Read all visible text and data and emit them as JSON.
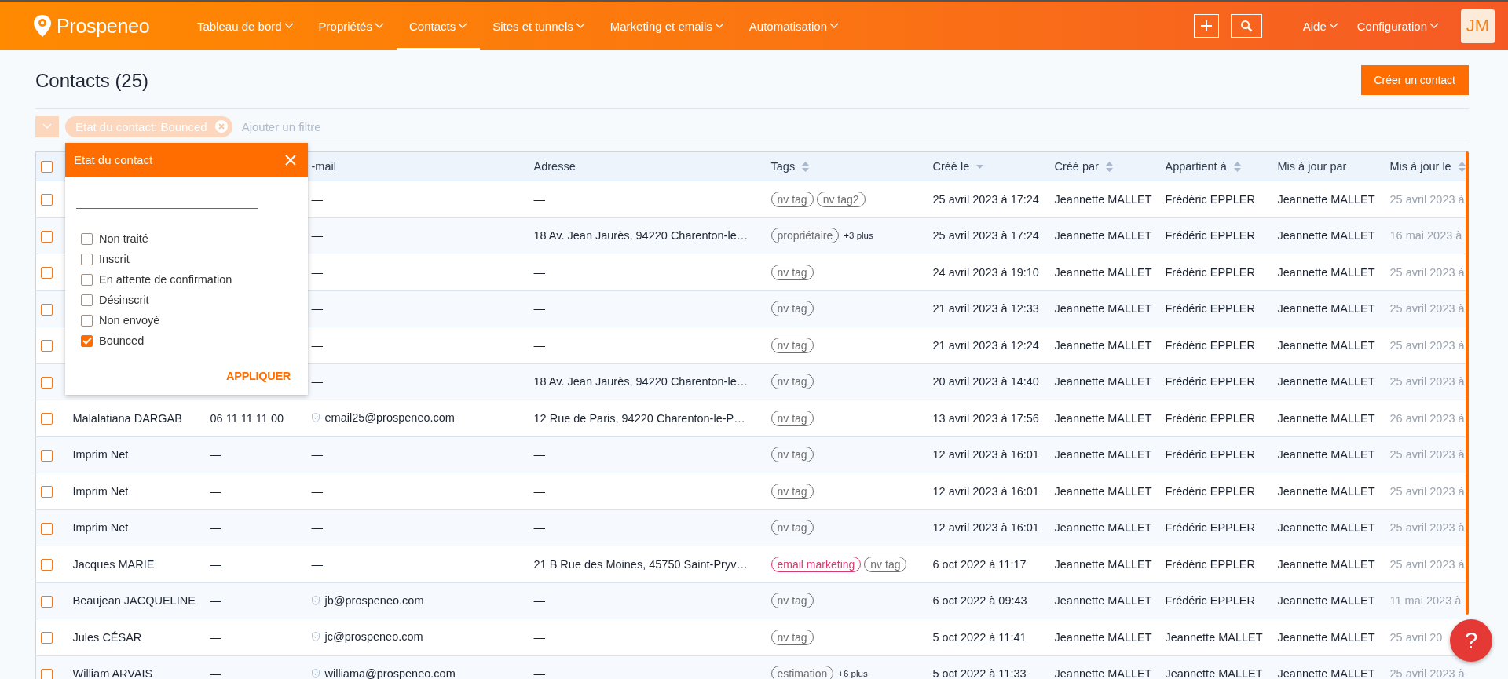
{
  "nav": {
    "logo": "**Prospe**neo",
    "items": [
      {
        "label": "Tableau de bord",
        "selected": false
      },
      {
        "label": "Propriétés",
        "selected": false
      },
      {
        "label": "Contacts",
        "selected": true
      },
      {
        "label": "Sites et tunnels",
        "selected": false
      },
      {
        "label": "Marketing et emails",
        "selected": false
      },
      {
        "label": "Automatisation",
        "selected": false
      }
    ],
    "menus": [
      {
        "label": "Aide"
      },
      {
        "label": "Configuration"
      }
    ],
    "avatar": "JM"
  },
  "page": {
    "title": "Contacts (25)",
    "create_button": "Créer un contact"
  },
  "filters": {
    "chips": [
      {
        "label": "Etat du contact: Bounced"
      }
    ],
    "add_placeholder": "Ajouter un filtre"
  },
  "table": {
    "header_checked": false,
    "columns": [
      {
        "label": "-mail",
        "sortable": false,
        "sorted_desc": false
      },
      {
        "label": "Adresse",
        "sortable": false,
        "sorted_desc": false
      },
      {
        "label": "Tags",
        "sortable": true,
        "sorted_desc": false
      },
      {
        "label": "Créé le",
        "sortable": true,
        "sorted_desc": true
      },
      {
        "label": "Créé par",
        "sortable": true,
        "sorted_desc": false
      },
      {
        "label": "Appartient à",
        "sortable": true,
        "sorted_desc": false
      },
      {
        "label": "Mis à jour par",
        "sortable": false,
        "sorted_desc": false
      },
      {
        "label": "Mis à jour le",
        "sortable": true,
        "sorted_desc": false
      }
    ],
    "rows": [
      {
        "checked": false,
        "email": "—",
        "verified": false,
        "address": "—",
        "tags": [
          {
            "label": "nv tag",
            "color": "#6f6f6f"
          },
          {
            "label": "nv tag2",
            "color": "#6f6f6f"
          }
        ],
        "created_on": "25 avril 2023 à 17:24",
        "created_by": "Jeannette MALLET",
        "owner": "Frédéric EPPLER",
        "updated_by": "Jeannette MALLET",
        "updated_on": "25 avril 2023 à"
      },
      {
        "checked": false,
        "email": "—",
        "verified": false,
        "address": "18 Av. Jean Jaurès, 94220 Charenton-le…",
        "tags": [
          {
            "label": "propriétaire",
            "color": "#6f6f6f"
          }
        ],
        "more": "+3 plus",
        "created_on": "25 avril 2023 à 17:24",
        "created_by": "Jeannette MALLET",
        "owner": "Frédéric EPPLER",
        "updated_by": "Jeannette MALLET",
        "updated_on": "16 mai 2023 à"
      },
      {
        "checked": false,
        "email": "—",
        "verified": false,
        "address": "—",
        "tags": [
          {
            "label": "nv tag",
            "color": "#6f6f6f"
          }
        ],
        "created_on": "24 avril 2023 à 19:10",
        "created_by": "Jeannette MALLET",
        "owner": "Frédéric EPPLER",
        "updated_by": "Jeannette MALLET",
        "updated_on": "25 avril 2023 à"
      },
      {
        "checked": false,
        "email": "—",
        "verified": false,
        "address": "—",
        "tags": [
          {
            "label": "nv tag",
            "color": "#6f6f6f"
          }
        ],
        "created_on": "21 avril 2023 à 12:33",
        "created_by": "Jeannette MALLET",
        "owner": "Frédéric EPPLER",
        "updated_by": "Jeannette MALLET",
        "updated_on": "25 avril 2023 à"
      },
      {
        "checked": false,
        "email": "—",
        "verified": false,
        "address": "—",
        "tags": [
          {
            "label": "nv tag",
            "color": "#6f6f6f"
          }
        ],
        "created_on": "21 avril 2023 à 12:24",
        "created_by": "Jeannette MALLET",
        "owner": "Frédéric EPPLER",
        "updated_by": "Jeannette MALLET",
        "updated_on": "25 avril 2023 à"
      },
      {
        "checked": false,
        "email": "—",
        "verified": false,
        "address": "18 Av. Jean Jaurès, 94220 Charenton-le…",
        "tags": [
          {
            "label": "nv tag",
            "color": "#6f6f6f"
          }
        ],
        "created_on": "20 avril 2023 à 14:40",
        "created_by": "Jeannette MALLET",
        "owner": "Frédéric EPPLER",
        "updated_by": "Jeannette MALLET",
        "updated_on": "25 avril 2023 à"
      },
      {
        "checked": false,
        "name": "Malalatiana DARGAB",
        "phone": "06 11 11 11 00",
        "email": "email25@prospeneo.com",
        "verified": true,
        "address": "12 Rue de Paris, 94220 Charenton-le-P…",
        "tags": [
          {
            "label": "nv tag",
            "color": "#6f6f6f"
          }
        ],
        "created_on": "13 avril 2023 à 17:56",
        "created_by": "Jeannette MALLET",
        "owner": "Frédéric EPPLER",
        "updated_by": "Jeannette MALLET",
        "updated_on": "26 avril 2023 à"
      },
      {
        "checked": false,
        "name": "Imprim Net",
        "phone": "—",
        "email": "—",
        "verified": false,
        "address": "—",
        "tags": [
          {
            "label": "nv tag",
            "color": "#6f6f6f"
          }
        ],
        "created_on": "12 avril 2023 à 16:01",
        "created_by": "Jeannette MALLET",
        "owner": "Frédéric EPPLER",
        "updated_by": "Jeannette MALLET",
        "updated_on": "25 avril 2023 à"
      },
      {
        "checked": false,
        "name": "Imprim Net",
        "phone": "—",
        "email": "—",
        "verified": false,
        "address": "—",
        "tags": [
          {
            "label": "nv tag",
            "color": "#6f6f6f"
          }
        ],
        "created_on": "12 avril 2023 à 16:01",
        "created_by": "Jeannette MALLET",
        "owner": "Frédéric EPPLER",
        "updated_by": "Jeannette MALLET",
        "updated_on": "25 avril 2023 à"
      },
      {
        "checked": false,
        "name": "Imprim Net",
        "phone": "—",
        "email": "—",
        "verified": false,
        "address": "—",
        "tags": [
          {
            "label": "nv tag",
            "color": "#6f6f6f"
          }
        ],
        "created_on": "12 avril 2023 à 16:01",
        "created_by": "Jeannette MALLET",
        "owner": "Frédéric EPPLER",
        "updated_by": "Jeannette MALLET",
        "updated_on": "25 avril 2023 à"
      },
      {
        "checked": false,
        "name": "Jacques MARIE",
        "phone": "—",
        "email": "—",
        "verified": false,
        "address": "21 B Rue des Moines, 45750 Saint-Pryv…",
        "tags": [
          {
            "label": "email marketing",
            "color": "#d63a6e"
          },
          {
            "label": "nv tag",
            "color": "#6f6f6f"
          }
        ],
        "created_on": "6 oct 2022 à 11:17",
        "created_by": "Jeannette MALLET",
        "owner": "Frédéric EPPLER",
        "updated_by": "Jeannette MALLET",
        "updated_on": "25 avril 2023 à"
      },
      {
        "checked": false,
        "name": "Beaujean JACQUELINE",
        "phone": "—",
        "email": "jb@prospeneo.com",
        "verified": true,
        "address": "—",
        "tags": [
          {
            "label": "nv tag",
            "color": "#6f6f6f"
          }
        ],
        "created_on": "6 oct 2022 à 09:43",
        "created_by": "Jeannette MALLET",
        "owner": "Frédéric EPPLER",
        "updated_by": "Jeannette MALLET",
        "updated_on": "11 mai 2023 à"
      },
      {
        "checked": false,
        "name": "Jules CÉSAR",
        "phone": "—",
        "email": "jc@prospeneo.com",
        "verified": true,
        "address": "—",
        "tags": [
          {
            "label": "nv tag",
            "color": "#6f6f6f"
          }
        ],
        "created_on": "5 oct 2022 à 11:41",
        "created_by": "Jeannette MALLET",
        "owner": "Jeannette MALLET",
        "updated_by": "Jeannette MALLET",
        "updated_on": "25 avril 20"
      },
      {
        "checked": false,
        "name": "William ARVAIS",
        "phone": "—",
        "email": "williama@prospeneo.com",
        "verified": true,
        "address": "—",
        "tags": [
          {
            "label": "estimation",
            "color": "#6f6f6f"
          }
        ],
        "more": "+6 plus",
        "created_on": "5 oct 2022 à 11:33",
        "created_by": "Jeannette MALLET",
        "owner": "Jeannette MALLET",
        "updated_by": "Jeannette MALLET",
        "updated_on": "25 avril 2023 à"
      }
    ]
  },
  "filter_popup": {
    "title": "Etat du contact",
    "options": [
      {
        "label": "Non traité",
        "checked": false
      },
      {
        "label": "Inscrit",
        "checked": false
      },
      {
        "label": "En attente de confirmation",
        "checked": false
      },
      {
        "label": "Désinscrit",
        "checked": false
      },
      {
        "label": "Non envoyé",
        "checked": false
      },
      {
        "label": "Bounced",
        "checked": true
      }
    ],
    "apply": "APPLIQUER"
  },
  "help_button": "?"
}
